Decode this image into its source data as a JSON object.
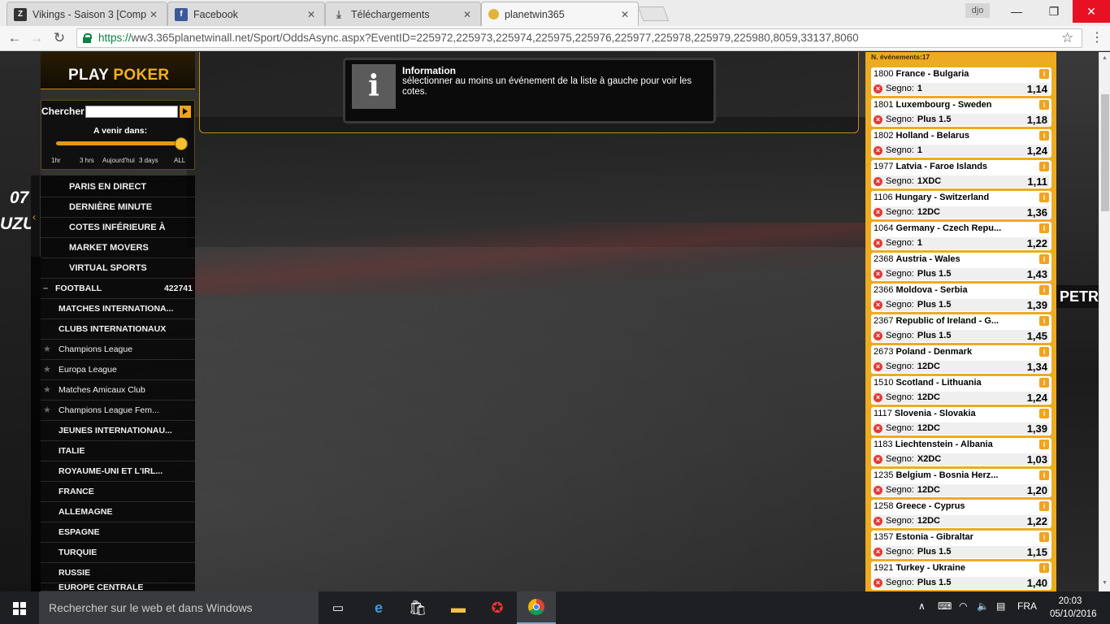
{
  "browser": {
    "tabs": [
      {
        "title": "Vikings - Saison 3 [Comp",
        "icon": "zt-icon"
      },
      {
        "title": "Facebook",
        "icon": "facebook-icon"
      },
      {
        "title": "Téléchargements",
        "icon": "download-icon"
      },
      {
        "title": "planetwin365",
        "icon": "planetwin-icon"
      }
    ],
    "user": "djo",
    "url_scheme": "https://",
    "url_rest": "ww3.365planetwinall.net/Sport/OddsAsync.aspx?EventID=225972,225973,225974,225975,225976,225977,225978,225979,225980,8059,33137,8060"
  },
  "site": {
    "poker_play": "PLAY",
    "poker_poker": "POKER",
    "search_label": "Chercher",
    "upcoming_label": "A venir dans:",
    "time_filters": [
      "1hr",
      "3 hrs",
      "Aujourd'hui",
      "3 days",
      "ALL"
    ],
    "deco_text_1": "07",
    "deco_text_2": "UZU",
    "deco_petr": "PETR",
    "nav_top": [
      "PARIS EN DIRECT",
      "DERNIÈRE MINUTE",
      "COTES INFÉRIEURE À",
      "MARKET MOVERS",
      "VIRTUAL SPORTS"
    ],
    "football_label": "FOOTBALL",
    "football_count": "422741",
    "leagues": [
      "MATCHES INTERNATIONA...",
      "CLUBS INTERNATIONAUX",
      "Champions League",
      "Europa League",
      "Matches Amicaux Club",
      "Champions League Fem...",
      "JEUNES INTERNATIONAU...",
      "ITALIE",
      "ROYAUME-UNI ET L'IRL...",
      "FRANCE",
      "ALLEMAGNE",
      "ESPAGNE",
      "TURQUIE",
      "RUSSIE",
      "EUROPE CENTRALE"
    ],
    "info_title": "Information",
    "info_message": "sélectionner au moins un événement de la liste à gauche pour voir les cotes.",
    "events_count_label": "N. événements:17",
    "segno_label": "Segno:",
    "matches": [
      {
        "code": "1800",
        "teams": "France - Bulgaria",
        "segno": "1",
        "odd": "1,14"
      },
      {
        "code": "1801",
        "teams": "Luxembourg - Sweden",
        "segno": "Plus 1.5",
        "odd": "1,18"
      },
      {
        "code": "1802",
        "teams": "Holland - Belarus",
        "segno": "1",
        "odd": "1,24"
      },
      {
        "code": "1977",
        "teams": "Latvia - Faroe Islands",
        "segno": "1XDC",
        "odd": "1,11"
      },
      {
        "code": "1106",
        "teams": "Hungary - Switzerland",
        "segno": "12DC",
        "odd": "1,36"
      },
      {
        "code": "1064",
        "teams": "Germany - Czech Repu...",
        "segno": "1",
        "odd": "1,22"
      },
      {
        "code": "2368",
        "teams": "Austria - Wales",
        "segno": "Plus 1.5",
        "odd": "1,43"
      },
      {
        "code": "2366",
        "teams": "Moldova - Serbia",
        "segno": "Plus 1.5",
        "odd": "1,39"
      },
      {
        "code": "2367",
        "teams": "Republic of Ireland - G...",
        "segno": "Plus 1.5",
        "odd": "1,45"
      },
      {
        "code": "2673",
        "teams": "Poland - Denmark",
        "segno": "12DC",
        "odd": "1,34"
      },
      {
        "code": "1510",
        "teams": "Scotland - Lithuania",
        "segno": "12DC",
        "odd": "1,24"
      },
      {
        "code": "1117",
        "teams": "Slovenia - Slovakia",
        "segno": "12DC",
        "odd": "1,39"
      },
      {
        "code": "1183",
        "teams": "Liechtenstein - Albania",
        "segno": "X2DC",
        "odd": "1,03"
      },
      {
        "code": "1235",
        "teams": "Belgium - Bosnia Herz...",
        "segno": "12DC",
        "odd": "1,20"
      },
      {
        "code": "1258",
        "teams": "Greece - Cyprus",
        "segno": "12DC",
        "odd": "1,22"
      },
      {
        "code": "1357",
        "teams": "Estonia - Gibraltar",
        "segno": "Plus 1.5",
        "odd": "1,15"
      },
      {
        "code": "1921",
        "teams": "Turkey - Ukraine",
        "segno": "Plus 1.5",
        "odd": "1,40"
      }
    ]
  },
  "taskbar": {
    "search_placeholder": "Rechercher sur le web et dans Windows",
    "language": "FRA",
    "time": "20:03",
    "date": "05/10/2016"
  },
  "colors": {
    "accent": "#ecab22",
    "brand_orange": "#f2a31d"
  }
}
